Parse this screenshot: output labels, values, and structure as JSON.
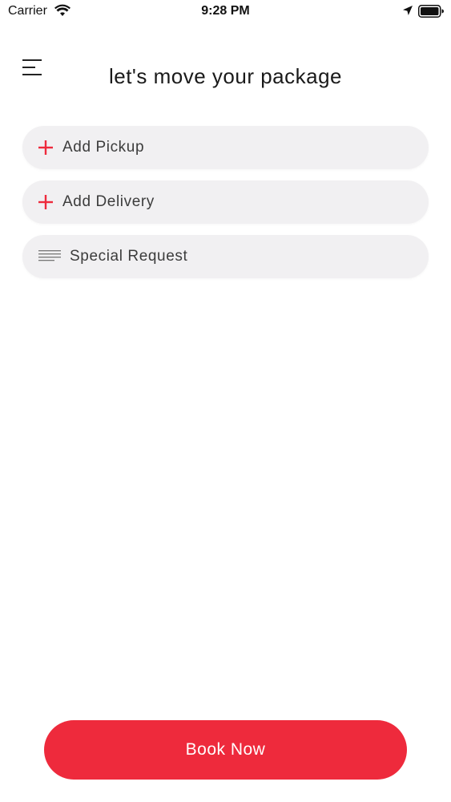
{
  "status_bar": {
    "carrier": "Carrier",
    "time": "9:28 PM",
    "icons": [
      "wifi-icon",
      "location-arrow-icon",
      "battery-icon"
    ]
  },
  "header": {
    "menu_icon": "hamburger-menu-icon",
    "title": "let's move your package"
  },
  "fields": [
    {
      "label": "Add Pickup",
      "icon": "plus-icon"
    },
    {
      "label": "Add Delivery",
      "icon": "plus-icon"
    },
    {
      "label": "Special Request",
      "icon": "text-lines-icon"
    }
  ],
  "actions": {
    "book_label": "Book Now"
  },
  "colors": {
    "accent": "#ee2a3c",
    "field_background": "#f1f0f2",
    "text": "#3c3c3c"
  }
}
